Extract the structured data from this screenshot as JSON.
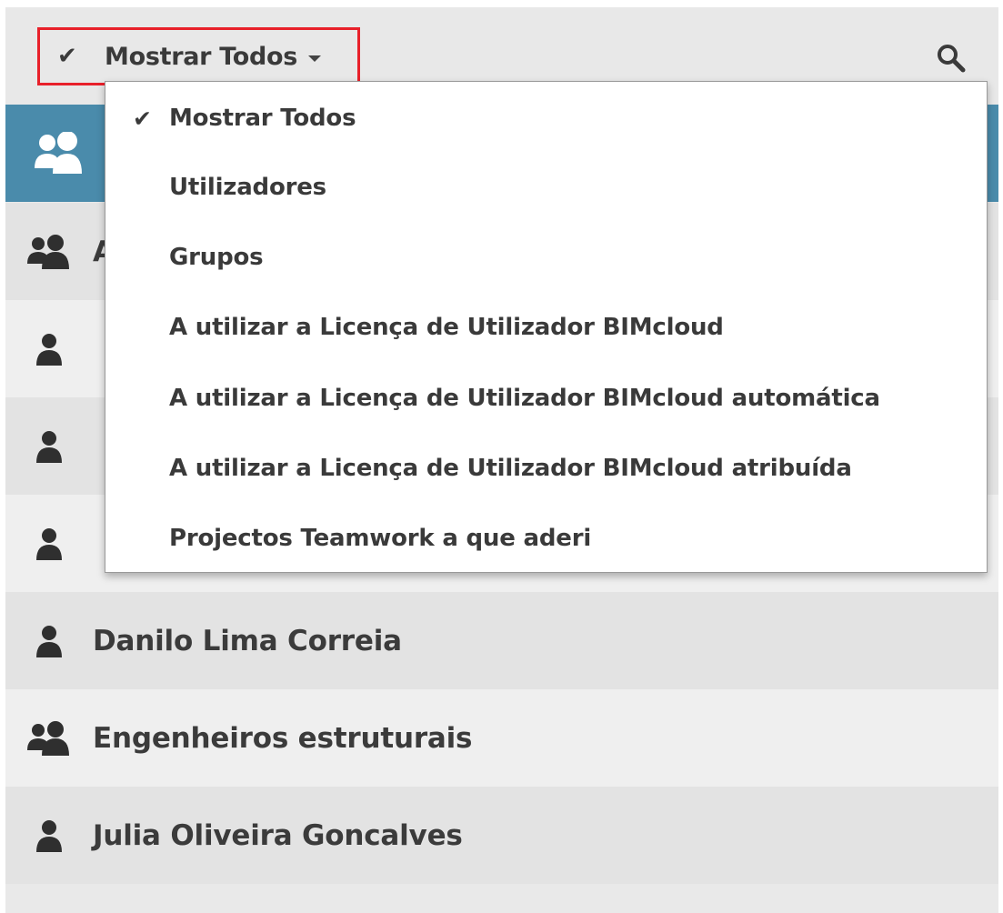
{
  "filter": {
    "selected_label": "Mostrar Todos",
    "check_glyph": "✔"
  },
  "icons": {
    "user": "user-icon",
    "group": "group-icon",
    "search": "search-icon"
  },
  "dropdown": {
    "items": [
      {
        "label": "Mostrar Todos",
        "checked": "✔"
      },
      {
        "label": "Utilizadores",
        "checked": ""
      },
      {
        "label": "Grupos",
        "checked": ""
      },
      {
        "label": "A utilizar a Licença de Utilizador BIMcloud",
        "checked": ""
      },
      {
        "label": "A utilizar a Licença de Utilizador BIMcloud automática",
        "checked": ""
      },
      {
        "label": "A utilizar a Licença de Utilizador BIMcloud atribuída",
        "checked": ""
      },
      {
        "label": "Projectos Teamwork a que aderi",
        "checked": ""
      }
    ]
  },
  "list": {
    "rows": [
      {
        "type": "group",
        "name": "A"
      },
      {
        "type": "user",
        "name": ""
      },
      {
        "type": "user",
        "name": ""
      },
      {
        "type": "user",
        "name": ""
      },
      {
        "type": "user",
        "name": "Danilo Lima Correia"
      },
      {
        "type": "group",
        "name": "Engenheiros estruturais"
      },
      {
        "type": "user",
        "name": "Julia Oliveira Goncalves"
      }
    ]
  },
  "colors": {
    "header_accent": "#4a8bab",
    "highlight_border": "#e8202a"
  }
}
